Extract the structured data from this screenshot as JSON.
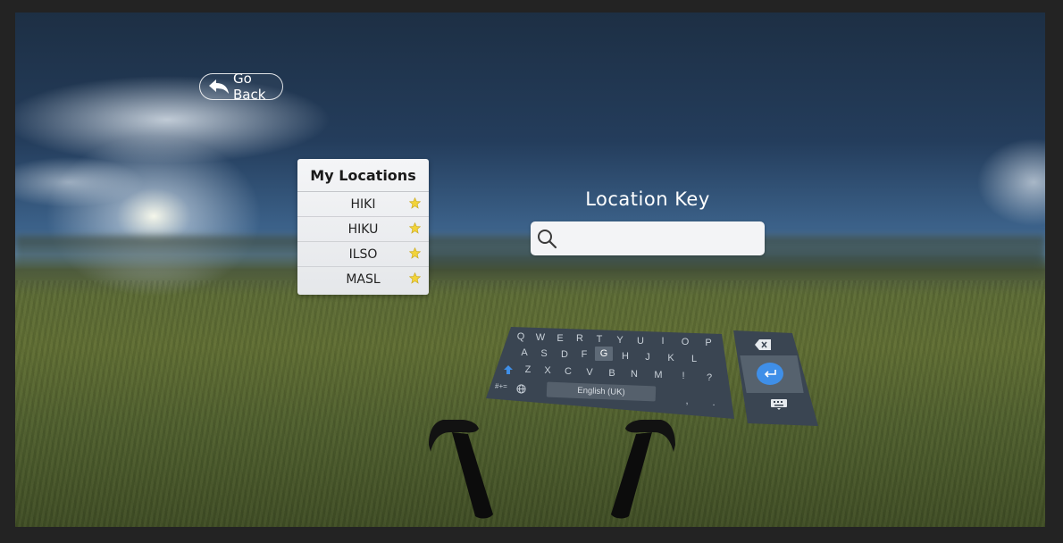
{
  "navigation": {
    "go_back_label": "Go Back"
  },
  "locations_panel": {
    "title": "My Locations",
    "items": [
      {
        "code": "HIKI",
        "favorite": true
      },
      {
        "code": "HIKU",
        "favorite": true
      },
      {
        "code": "ILSO",
        "favorite": true
      },
      {
        "code": "MASL",
        "favorite": true
      }
    ]
  },
  "location_key": {
    "title": "Location Key",
    "value": "",
    "placeholder": ""
  },
  "keyboard": {
    "row1": [
      "Q",
      "W",
      "E",
      "R",
      "T",
      "Y",
      "U",
      "I",
      "O",
      "P"
    ],
    "row2": [
      "A",
      "S",
      "D",
      "F",
      "G",
      "H",
      "J",
      "K",
      "L"
    ],
    "row3": [
      "Z",
      "X",
      "C",
      "V",
      "B",
      "N",
      "M",
      "!",
      "?"
    ],
    "symbols_key": "#+=",
    "comma": ",",
    "period": ".",
    "language": "English (UK)",
    "highlighted_key": "G"
  },
  "icons": {
    "back": "back-arrow-icon",
    "search": "search-icon",
    "star": "star-icon",
    "shift": "shift-icon",
    "globe": "globe-icon",
    "backspace": "backspace-icon",
    "enter": "enter-icon",
    "hide_keyboard": "keyboard-hide-icon",
    "controller": "vr-controller-icon"
  },
  "colors": {
    "accent": "#3f8fe8",
    "star": "#f2d33a",
    "keyboard_bg": "#3a4552"
  }
}
